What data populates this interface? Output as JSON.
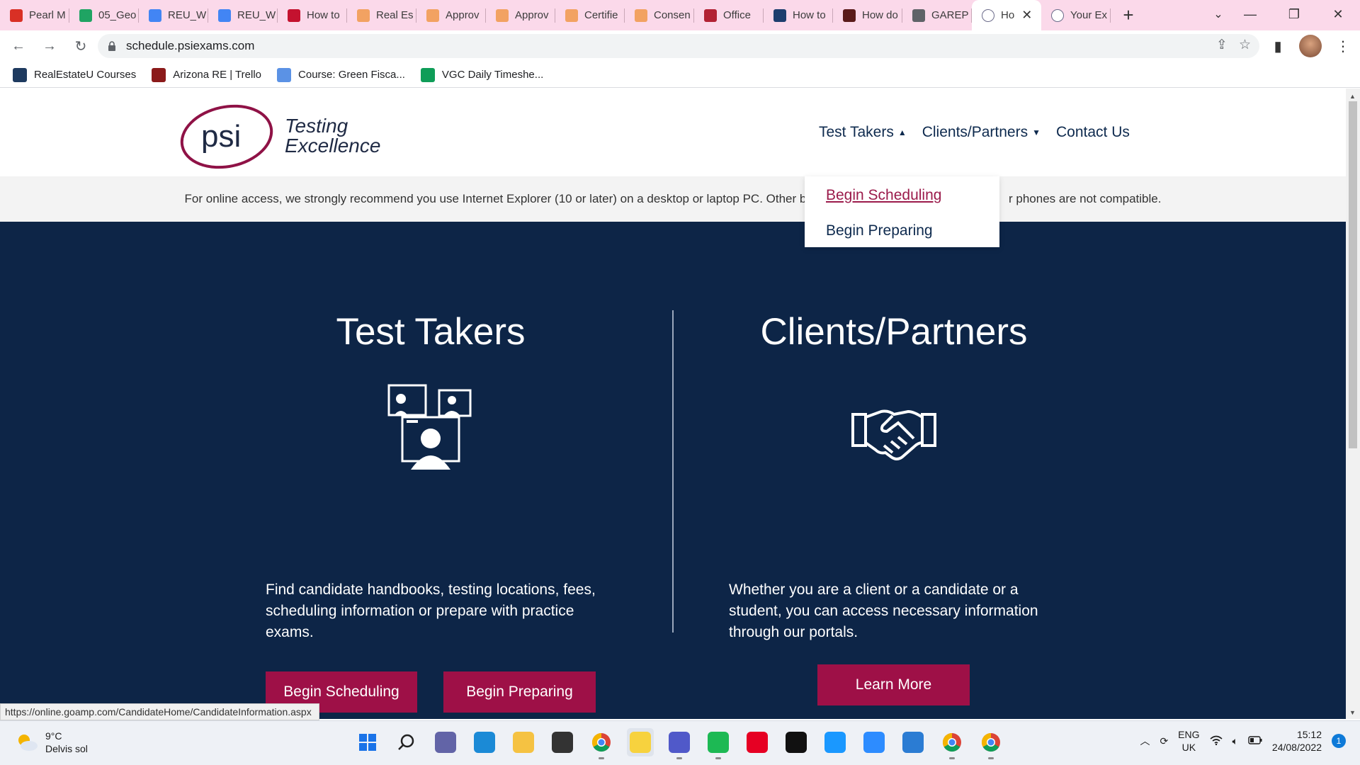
{
  "browser": {
    "tabs": [
      {
        "label": "Pearl M",
        "icon": "gmail-icon",
        "color": "#d93025"
      },
      {
        "label": "05_Geo",
        "icon": "google-drive-icon",
        "color": "#1fa463"
      },
      {
        "label": "REU_W",
        "icon": "google-docs-icon",
        "color": "#4285f4"
      },
      {
        "label": "REU_W",
        "icon": "google-docs-icon",
        "color": "#4285f4"
      },
      {
        "label": "How to",
        "icon": "media-play-icon",
        "color": "#c4122f"
      },
      {
        "label": "Real Es",
        "icon": "peach-icon",
        "color": "#f2a262"
      },
      {
        "label": "Approv",
        "icon": "peach-icon",
        "color": "#f2a262"
      },
      {
        "label": "Approv",
        "icon": "peach-icon",
        "color": "#f2a262"
      },
      {
        "label": "Certifie",
        "icon": "peach-icon",
        "color": "#f2a262"
      },
      {
        "label": "Consen",
        "icon": "peach-icon",
        "color": "#f2a262"
      },
      {
        "label": "Office",
        "icon": "flag-icon",
        "color": "#b22234"
      },
      {
        "label": "How to",
        "icon": "graduation-cap-icon",
        "color": "#1d3e6e"
      },
      {
        "label": "How do",
        "icon": "reu-logo-icon",
        "color": "#5a1a1a"
      },
      {
        "label": "GAREP",
        "icon": "globe-icon",
        "color": "#5f6368"
      }
    ],
    "active_tab": {
      "label": "Ho",
      "icon": "psi-icon"
    },
    "last_tab": {
      "label": "Your Ex",
      "icon": "psi-icon"
    },
    "new_tab": "+",
    "tab_search": "⌄",
    "window_controls": {
      "minimize": "—",
      "maximize": "❐",
      "close": "✕"
    },
    "url": "schedule.psiexams.com",
    "nav": {
      "back": "←",
      "forward": "→",
      "reload": "↻"
    },
    "omni_actions": {
      "share": "⇪",
      "bookmark": "☆"
    },
    "toolbar_actions": {
      "sidepanel": "▮",
      "menu": "⋮"
    },
    "bookmarks": [
      {
        "label": "RealEstateU Courses",
        "icon": "realestateu-icon",
        "color": "#1e3a5f"
      },
      {
        "label": "Arizona RE | Trello",
        "icon": "trello-icon",
        "color": "#8b1a1a"
      },
      {
        "label": "Course: Green Fisca...",
        "icon": "un-globe-icon",
        "color": "#5b92e5"
      },
      {
        "label": "VGC Daily Timeshe...",
        "icon": "google-sheets-icon",
        "color": "#0f9d58"
      }
    ]
  },
  "site": {
    "logo_text": "psi",
    "logo_tagline_1": "Testing",
    "logo_tagline_2": "Excellence",
    "nav": [
      {
        "label": "Test Takers",
        "chevron": "▲"
      },
      {
        "label": "Clients/Partners",
        "chevron": "▼"
      },
      {
        "label": "Contact Us"
      }
    ],
    "dropdown": [
      "Begin Scheduling",
      "Begin Preparing"
    ],
    "notice": "For online access, we strongly recommend you use Internet Explorer (10 or later) on a desktop or laptop PC. Other br",
    "notice_tail": "r phones are not compatible.",
    "test_takers": {
      "title": "Test Takers",
      "text": "Find candidate handbooks, testing locations, fees, scheduling information or prepare with practice exams.",
      "btn_schedule": "Begin Scheduling",
      "btn_prepare": "Begin Preparing"
    },
    "clients": {
      "title": "Clients/Partners",
      "text": "Whether you are a client or a candidate or a student, you can access necessary information through our portals.",
      "btn_learn": "Learn More"
    },
    "colors": {
      "navy": "#0d2547",
      "brand": "#9e1047",
      "link": "#9b1b4b"
    }
  },
  "status_url": "https://online.goamp.com/CandidateHome/CandidateInformation.aspx",
  "taskbar": {
    "weather_temp": "9°C",
    "weather_desc": "Delvis sol",
    "apps": [
      {
        "name": "windows-start-icon",
        "color": "#1a73e8"
      },
      {
        "name": "search-icon",
        "color": "#222"
      },
      {
        "name": "teams-chat-icon",
        "color": "#6264a7"
      },
      {
        "name": "edge-icon",
        "color": "#1b8ad6"
      },
      {
        "name": "file-explorer-icon",
        "color": "#f5c242"
      },
      {
        "name": "store-icon",
        "color": "#333"
      },
      {
        "name": "chrome-icon",
        "color": "#db4437"
      },
      {
        "name": "sticky-notes-icon",
        "color": "#f7d23e"
      },
      {
        "name": "teams-icon",
        "color": "#5059c9"
      },
      {
        "name": "spotify-icon",
        "color": "#1db954"
      },
      {
        "name": "pinterest-icon",
        "color": "#e60023"
      },
      {
        "name": "netflix-icon",
        "color": "#111"
      },
      {
        "name": "prime-video-icon",
        "color": "#1a98ff"
      },
      {
        "name": "zoom-icon",
        "color": "#2d8cff"
      },
      {
        "name": "todo-icon",
        "color": "#2b7cd3"
      },
      {
        "name": "chrome-profile-icon",
        "color": "#db4437"
      },
      {
        "name": "chrome-profile-2-icon",
        "color": "#db4437"
      }
    ],
    "lang_1": "ENG",
    "lang_2": "UK",
    "time": "15:12",
    "date": "24/08/2022",
    "notifications": "1"
  }
}
